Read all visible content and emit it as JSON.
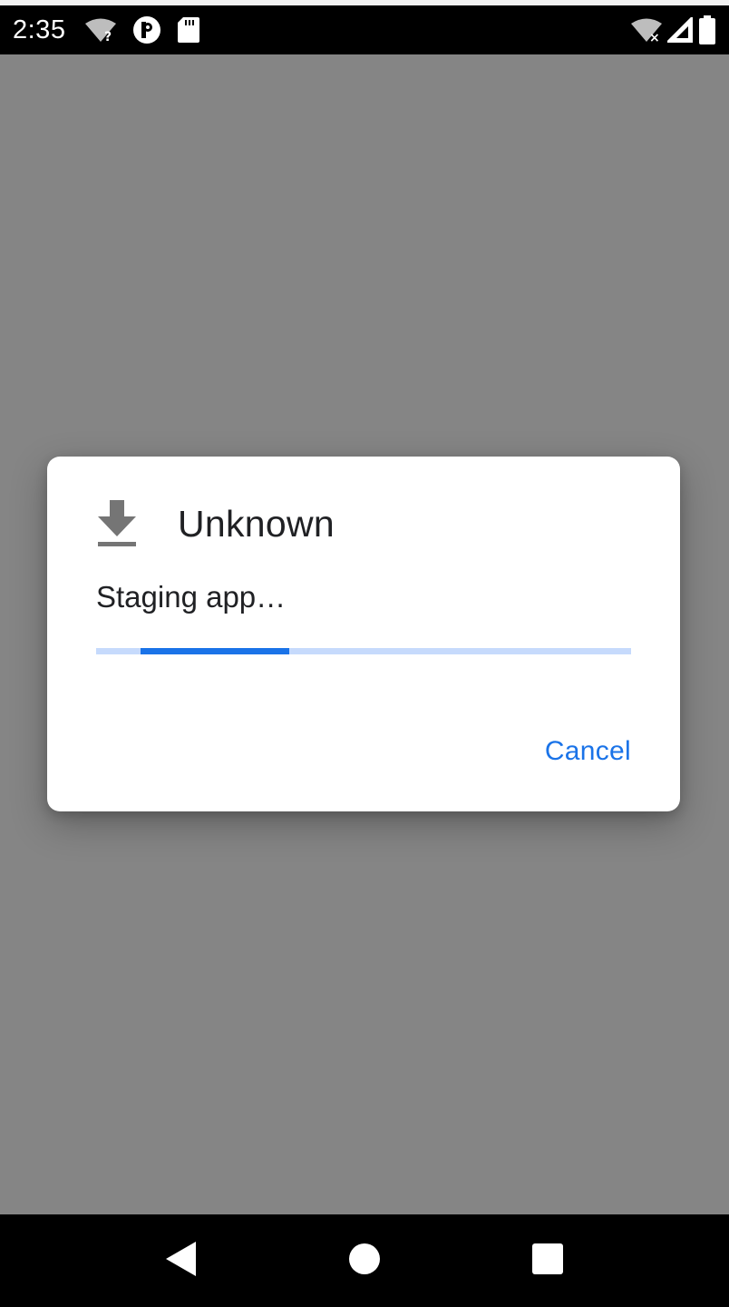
{
  "status_bar": {
    "time": "2:35",
    "left_icons": [
      "wifi-unknown-icon",
      "parking-app-icon",
      "sd-card-icon"
    ],
    "right_icons": [
      "wifi-off-icon",
      "cellular-signal-icon",
      "battery-icon"
    ]
  },
  "dialog": {
    "icon": "download-icon",
    "title": "Unknown",
    "message": "Staging app…",
    "progress": {
      "mode": "indeterminate",
      "track_color": "#c6dafc",
      "indicator_color": "#1a73e8"
    },
    "cancel_label": "Cancel"
  },
  "nav_bar": {
    "buttons": [
      "back-icon",
      "home-icon",
      "recents-icon"
    ]
  },
  "colors": {
    "accent": "#1a73e8",
    "scrim": "#858585"
  }
}
